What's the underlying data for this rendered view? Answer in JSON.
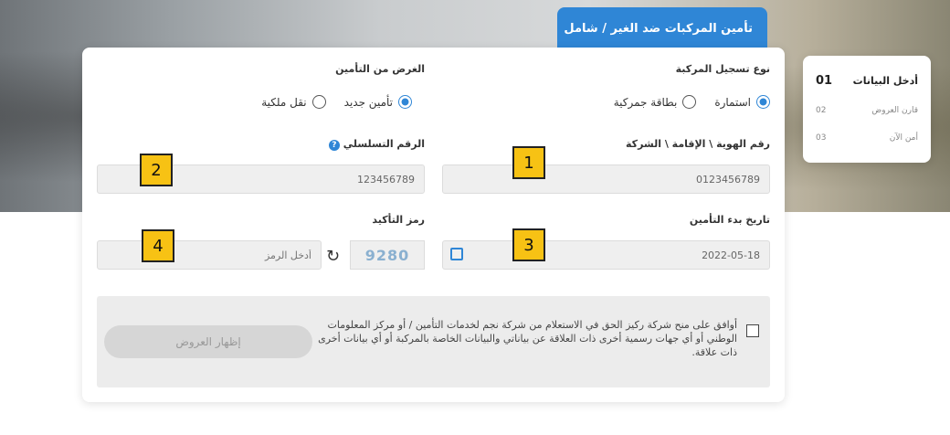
{
  "tab": {
    "label": "تأمين المركبات ضد الغير / شامل"
  },
  "form": {
    "registration_type": {
      "label": "نوع تسجيل المركبة",
      "options": [
        "استمارة",
        "بطاقة جمركية"
      ],
      "selected": "استمارة"
    },
    "purpose": {
      "label": "الغرض من التأمين",
      "options": [
        "تأمين جديد",
        "نقل ملكية"
      ],
      "selected": "تأمين جديد"
    },
    "id_number": {
      "label": "رقم الهوية \\ الإقامة \\ الشركة",
      "value": "0123456789"
    },
    "serial_number": {
      "label": "الرقم التسلسلي",
      "help": "?",
      "value": "123456789"
    },
    "start_date": {
      "label": "تاريخ بدء التأمين",
      "value": "2022-05-18"
    },
    "confirmation_code": {
      "label": "رمز التأكيد",
      "placeholder": "أدخل الرمز",
      "captcha": "9280"
    },
    "consent_text": "أوافق على منح شركة ركيز الحق في الاستعلام من شركة نجم لخدمات التأمين / أو مركز المعلومات الوطني أو أي جهات رسمية أخرى ذات العلاقة عن بياناتي والبيانات الخاصة بالمركبة أو أي بيانات أخرى ذات علاقة.",
    "submit_label": "إظهار العروض"
  },
  "steps": [
    {
      "number": "01",
      "label": "أدخل البيانات"
    },
    {
      "number": "02",
      "label": "قارن العروض"
    },
    {
      "number": "03",
      "label": "أمن الآن"
    }
  ],
  "markers": [
    "1",
    "2",
    "3",
    "4"
  ],
  "colors": {
    "accent": "#2f86d6",
    "marker": "#f7c214"
  }
}
